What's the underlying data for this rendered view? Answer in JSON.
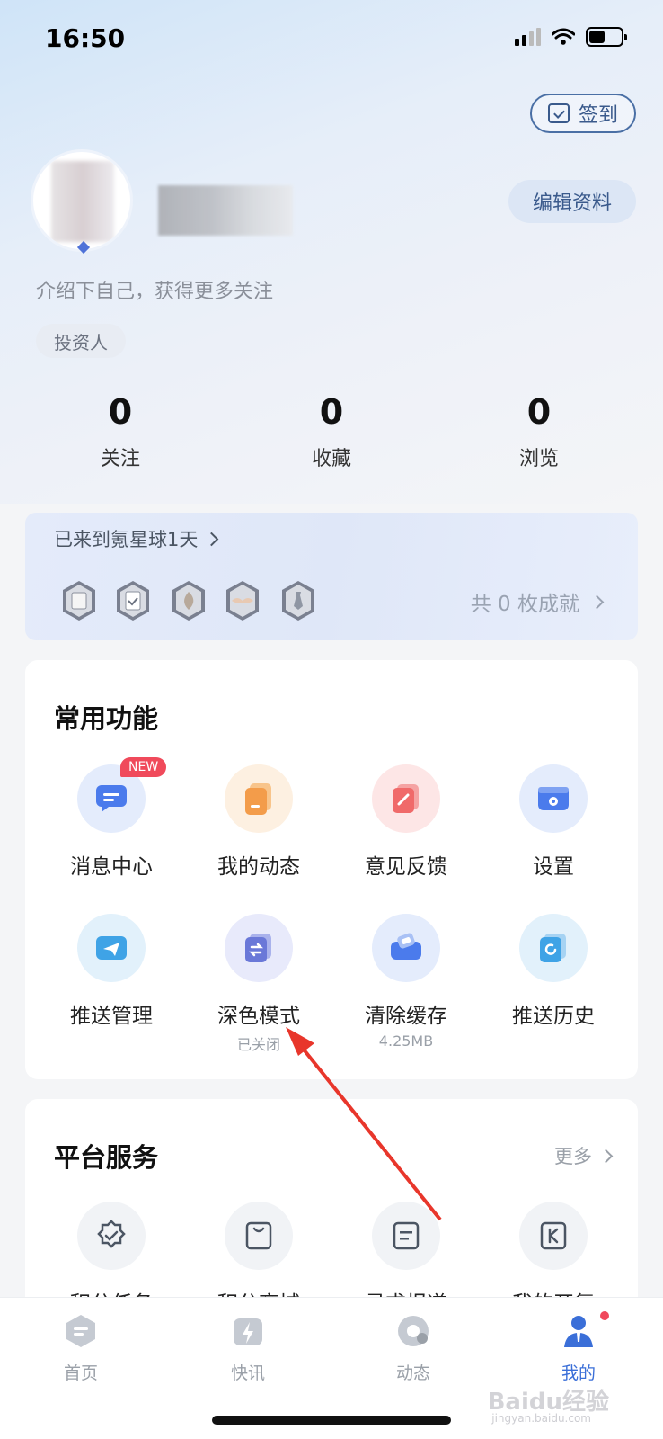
{
  "status_bar": {
    "time": "16:50"
  },
  "header": {
    "checkin_label": "签到",
    "edit_profile_label": "编辑资料"
  },
  "profile": {
    "bio": "介绍下自己，获得更多关注",
    "tag": "投资人"
  },
  "stats": [
    {
      "value": "0",
      "label": "关注"
    },
    {
      "value": "0",
      "label": "收藏"
    },
    {
      "value": "0",
      "label": "浏览"
    }
  ],
  "achievements": {
    "days_text": "已来到氪星球1天",
    "count_text": "共 0 枚成就",
    "badge_icons": [
      "scroll-badge-icon",
      "clipboard-badge-icon",
      "flame-badge-icon",
      "wings-badge-icon",
      "tie-badge-icon"
    ]
  },
  "common_functions": {
    "title": "常用功能",
    "items": [
      {
        "label": "消息中心",
        "badge": "NEW",
        "icon": "message-icon",
        "color": "#4b7bec"
      },
      {
        "label": "我的动态",
        "icon": "document-icon",
        "color": "#f39c4a"
      },
      {
        "label": "意见反馈",
        "icon": "feedback-icon",
        "color": "#f06a6a"
      },
      {
        "label": "设置",
        "icon": "settings-icon",
        "color": "#4b7bec"
      },
      {
        "label": "推送管理",
        "icon": "send-icon",
        "color": "#3fa3e6"
      },
      {
        "label": "深色模式",
        "sub": "已关闭",
        "icon": "dark-mode-icon",
        "color": "#6a78d8"
      },
      {
        "label": "清除缓存",
        "sub": "4.25MB",
        "icon": "eraser-icon",
        "color": "#4b7bec"
      },
      {
        "label": "推送历史",
        "icon": "push-history-icon",
        "color": "#3fa3e6"
      }
    ]
  },
  "platform_services": {
    "title": "平台服务",
    "more_label": "更多",
    "items": [
      {
        "label": "积分任务",
        "icon": "badge-check-icon"
      },
      {
        "label": "积分商城",
        "icon": "shopping-bag-icon"
      },
      {
        "label": "寻求报道",
        "icon": "report-doc-icon"
      },
      {
        "label": "我的开氪",
        "icon": "k-icon"
      }
    ]
  },
  "bottom_nav": [
    {
      "label": "首页",
      "icon": "home-icon"
    },
    {
      "label": "快讯",
      "icon": "flash-icon"
    },
    {
      "label": "动态",
      "icon": "dynamic-icon"
    },
    {
      "label": "我的",
      "icon": "profile-icon",
      "active": true
    }
  ],
  "colors": {
    "accent": "#3b6fd8",
    "arrow": "#e8362b"
  },
  "watermark": {
    "text": "Baidu经验",
    "sub": "jingyan.baidu.com"
  }
}
